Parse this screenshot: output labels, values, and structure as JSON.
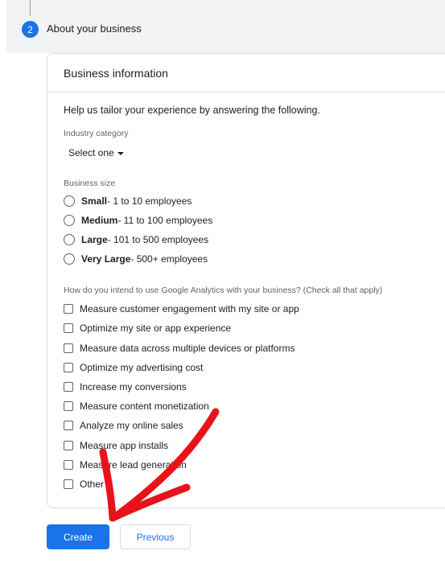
{
  "step": {
    "number": "2",
    "title": "About your business"
  },
  "card": {
    "title": "Business information",
    "intro": "Help us tailor your experience by answering the following."
  },
  "industry": {
    "label": "Industry category",
    "selected": "Select one"
  },
  "business_size": {
    "label": "Business size",
    "options": [
      {
        "name": "Small",
        "detail": " - 1 to 10 employees"
      },
      {
        "name": "Medium",
        "detail": " - 11 to 100 employees"
      },
      {
        "name": "Large",
        "detail": " - 101 to 500 employees"
      },
      {
        "name": "Very Large",
        "detail": " - 500+ employees"
      }
    ]
  },
  "usage": {
    "label": "How do you intend to use Google Analytics with your business? (Check all that apply)",
    "options": [
      "Measure customer engagement with my site or app",
      "Optimize my site or app experience",
      "Measure data across multiple devices or platforms",
      "Optimize my advertising cost",
      "Increase my conversions",
      "Measure content monetization",
      "Analyze my online sales",
      "Measure app installs",
      "Measure lead generation",
      "Other"
    ]
  },
  "buttons": {
    "create": "Create",
    "previous": "Previous"
  },
  "colors": {
    "accent": "#1a73e8",
    "annotation_arrow": "#e8121b"
  }
}
